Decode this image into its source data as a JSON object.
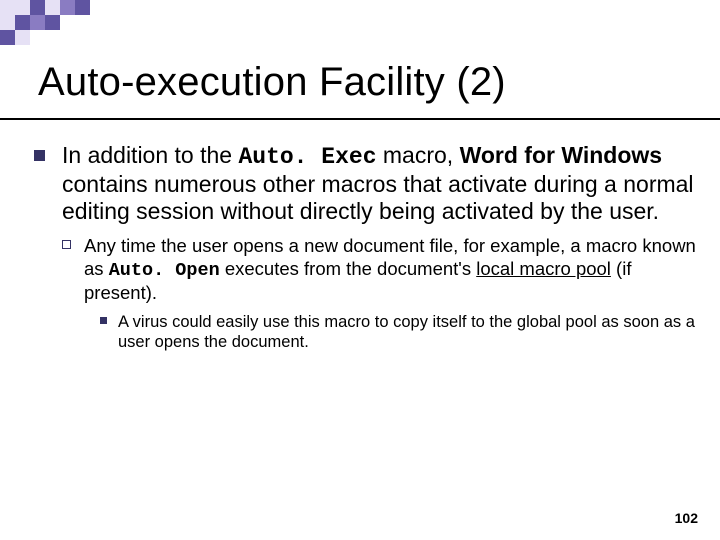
{
  "title": "Auto-execution Facility (2)",
  "l1": {
    "pre": "In addition to the ",
    "macro1": "Auto. Exec",
    "mid1": " macro, ",
    "bold1": "Word for Windows",
    "post": " contains numerous other macros that activate during a normal editing session without directly being activated by the user."
  },
  "l2": {
    "pre": "Any time the user opens a new document file, for example, a macro known as ",
    "macro2": "Auto. Open",
    "mid": " executes from the document's ",
    "underlined": "local macro pool",
    "post": " (if present)."
  },
  "l3": {
    "text": "A virus could easily use this macro to copy itself to the global pool as soon as a user opens the document."
  },
  "page_number": "102"
}
